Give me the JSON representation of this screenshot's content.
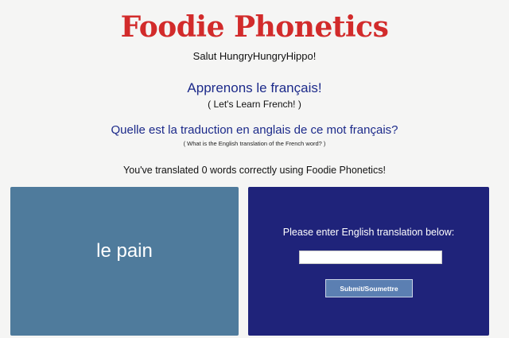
{
  "header": {
    "logo_text": "Foodie Phonetics",
    "greeting": "Salut HungryHungryHippo!"
  },
  "intro": {
    "title_fr": "Apprenons le français!",
    "title_en": "( Let's Learn French! )"
  },
  "question": {
    "prompt_fr": "Quelle est la traduction en anglais de ce mot français?",
    "prompt_en": "( What is the English translation of the French word? )"
  },
  "score_text": "You've translated 0 words correctly using Foodie Phonetics!",
  "word_card": {
    "word": "le pain"
  },
  "answer_card": {
    "instruction": "Please enter English translation below:",
    "input_value": "",
    "submit_label": "Submit/Soumettre"
  },
  "colors": {
    "logo": "#d22b2b",
    "heading": "#1c2a8a",
    "word_card_bg": "#4f7b9c",
    "answer_card_bg": "#1f237a",
    "button_bg": "#5b7fb2"
  }
}
